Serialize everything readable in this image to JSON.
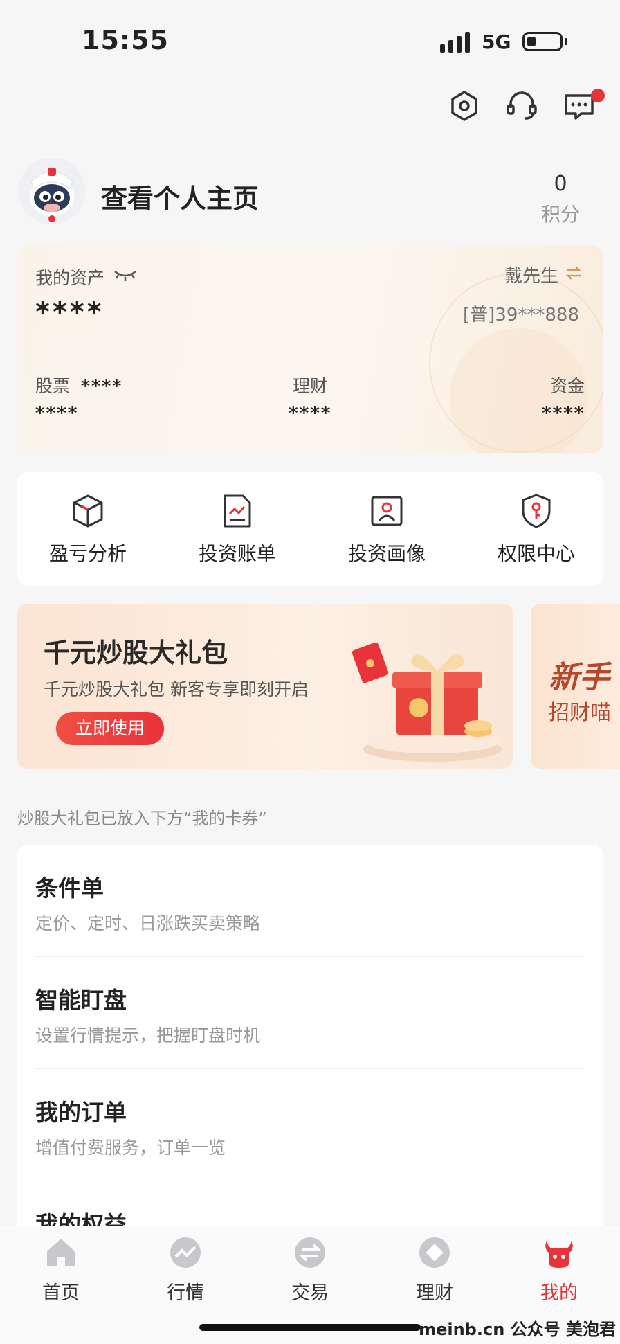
{
  "status": {
    "time": "15:55",
    "network": "5G"
  },
  "profile": {
    "link_label": "查看个人主页",
    "points_value": "0",
    "points_label": "积分"
  },
  "assets": {
    "label": "我的资产",
    "total": "****",
    "user_name": "戴先生",
    "account": "[普]39***888",
    "columns": [
      {
        "label": "股票",
        "extra": "****",
        "value": "****"
      },
      {
        "label": "理财",
        "value": "****"
      },
      {
        "label": "资金",
        "value": "****"
      }
    ]
  },
  "tools": [
    {
      "label": "盈亏分析",
      "icon": "cube-icon"
    },
    {
      "label": "投资账单",
      "icon": "chart-doc-icon"
    },
    {
      "label": "投资画像",
      "icon": "portrait-icon"
    },
    {
      "label": "权限中心",
      "icon": "shield-key-icon"
    }
  ],
  "banner": {
    "title": "千元炒股大礼包",
    "subtitle": "千元炒股大礼包 新客专享即刻开启",
    "button": "立即使用"
  },
  "banner2": {
    "title": "新手",
    "subtitle": "招财喵"
  },
  "voucher_note": "炒股大礼包已放入下方“我的卡券”",
  "services": [
    {
      "title": "条件单",
      "desc": "定价、定时、日涨跌买卖策略"
    },
    {
      "title": "智能盯盘",
      "desc": "设置行情提示，把握盯盘时机"
    },
    {
      "title": "我的订单",
      "desc": "增值付费服务，订单一览"
    },
    {
      "title": "我的权益",
      "desc": ""
    }
  ],
  "tabs": [
    {
      "label": "首页",
      "icon": "home-icon",
      "active": false
    },
    {
      "label": "行情",
      "icon": "market-icon",
      "active": false
    },
    {
      "label": "交易",
      "icon": "trade-icon",
      "active": false
    },
    {
      "label": "理财",
      "icon": "wealth-icon",
      "active": false
    },
    {
      "label": "我的",
      "icon": "bull-icon",
      "active": true
    }
  ],
  "watermark": "meinb.cn 公众号 美泡君",
  "colors": {
    "accent": "#e8333a",
    "gold": "#c9a064"
  }
}
